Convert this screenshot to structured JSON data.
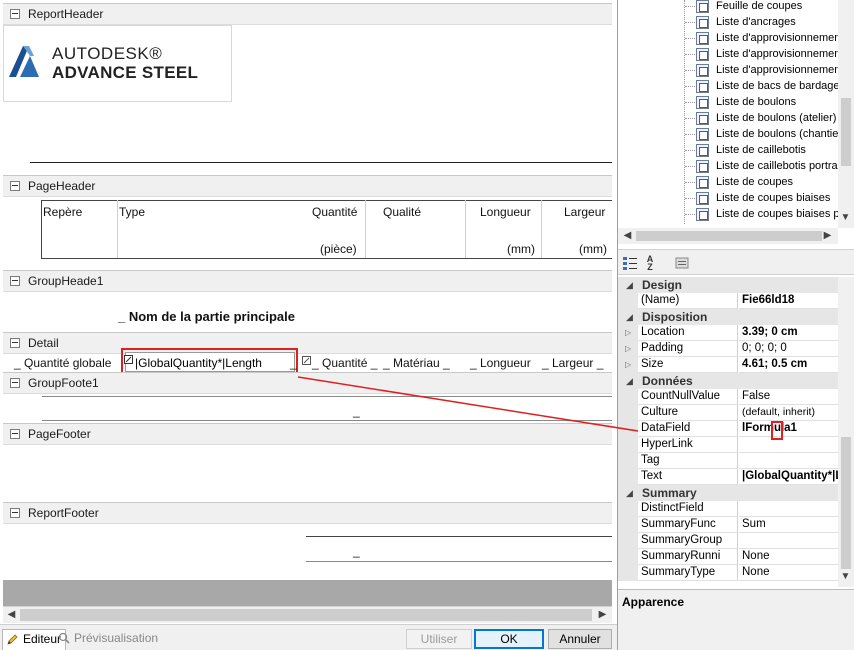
{
  "bands": {
    "report_header": "ReportHeader",
    "page_header": "PageHeader",
    "group_header": "GroupHeade1",
    "detail": "Detail",
    "group_footer": "GroupFoote1",
    "page_footer": "PageFooter",
    "report_footer": "ReportFooter"
  },
  "logo": {
    "line1": "AUTODESK®",
    "line2": "ADVANCE STEEL"
  },
  "page_header": {
    "col_repere": "Repère",
    "col_type": "Type",
    "col_quantite": "Quantité",
    "col_qualite": "Qualité",
    "col_longueur": "Longueur",
    "col_largeur": "Largeur",
    "unit_piece": "(pièce)",
    "unit_mm1": "(mm)",
    "unit_mm2": "(mm)"
  },
  "group_header": {
    "title": "_ Nom de la partie principale"
  },
  "detail": {
    "f1": "_ Quantité globale",
    "f2": "|GlobalQuantity*|Length",
    "f3": "_ Quantité _",
    "f4": "_ Matériau _",
    "f5": "_ Longueur",
    "f6": "_ Largeur _"
  },
  "group_footer": {
    "mark": "_"
  },
  "report_footer": {
    "mark": "_"
  },
  "bottom": {
    "tab_editor": "Editeur",
    "tab_preview": "Prévisualisation",
    "btn_use": "Utiliser",
    "btn_ok": "OK",
    "btn_cancel": "Annuler"
  },
  "tree": {
    "items": [
      "Feuille de coupes",
      "Liste d'ancrages",
      "Liste d'approvisionnement",
      "Liste d'approvisionnement",
      "Liste d'approvisionnement",
      "Liste de bacs de bardage",
      "Liste de boulons",
      "Liste de boulons (atelier)",
      "Liste de boulons (chantier",
      "Liste de caillebotis",
      "Liste de caillebotis portrait",
      "Liste de coupes",
      "Liste de coupes biaises",
      "Liste de coupes biaises po"
    ]
  },
  "properties": {
    "cat_design": "Design",
    "name_key": "(Name)",
    "name_val": "Fie66ld18",
    "cat_layout": "Disposition",
    "location_key": "Location",
    "location_val": "3.39; 0 cm",
    "padding_key": "Padding",
    "padding_val": "0; 0; 0; 0",
    "size_key": "Size",
    "size_val": "4.61; 0.5 cm",
    "cat_data": "Données",
    "countnull_key": "CountNullValue",
    "countnull_val": "False",
    "culture_key": "Culture",
    "culture_val": "(default, inherit)",
    "datafield_key": "DataField",
    "datafield_val": "lFormula1",
    "hyperlink_key": "HyperLink",
    "tag_key": "Tag",
    "text_key": "Text",
    "text_val": "|GlobalQuantity*|Len",
    "cat_summary": "Summary",
    "distinct_key": "DistinctField",
    "sumfunc_key": "SummaryFunc",
    "sumfunc_val": "Sum",
    "sumgroup_key": "SummaryGroup",
    "sumrun_key": "SummaryRunni",
    "sumrun_val": "None",
    "sumtype_key": "SummaryType",
    "sumtype_val": "None"
  },
  "description": {
    "title": "Apparence"
  },
  "colors": {
    "highlight_red": "#e02020",
    "ok_blue": "#0078d7"
  }
}
